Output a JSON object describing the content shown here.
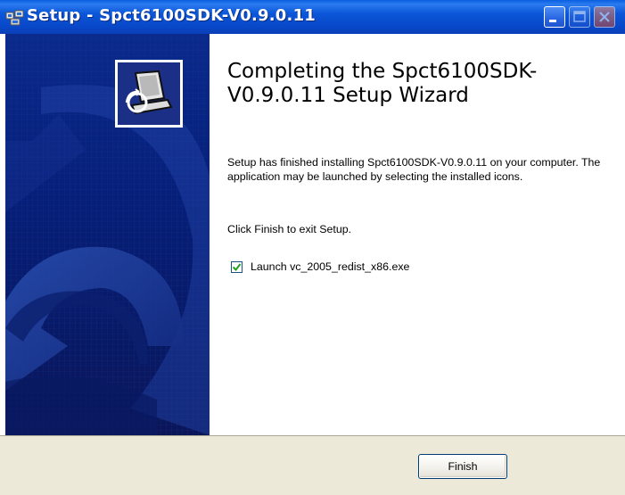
{
  "window": {
    "title": "Setup - Spct6100SDK-V0.9.0.11"
  },
  "title_bar_buttons": [
    "minimize",
    "maximize",
    "close"
  ],
  "content": {
    "heading": "Completing the Spct6100SDK-V0.9.0.11 Setup Wizard",
    "paragraph1": "Setup has finished installing Spct6100SDK-V0.9.0.11 on your computer. The application may be launched by selecting the installed icons.",
    "paragraph2": "Click Finish to exit Setup.",
    "launch_checkbox": {
      "label": "Launch vc_2005_redist_x86.exe",
      "checked": true
    }
  },
  "buttons": {
    "finish": "Finish"
  },
  "colors": {
    "titlebar": "#0a4fd6",
    "banner": "#0a2a8c",
    "button_face": "#ece9d8"
  },
  "icons": [
    "setup-app-icon",
    "installer-computer-icon",
    "checkmark-icon"
  ]
}
